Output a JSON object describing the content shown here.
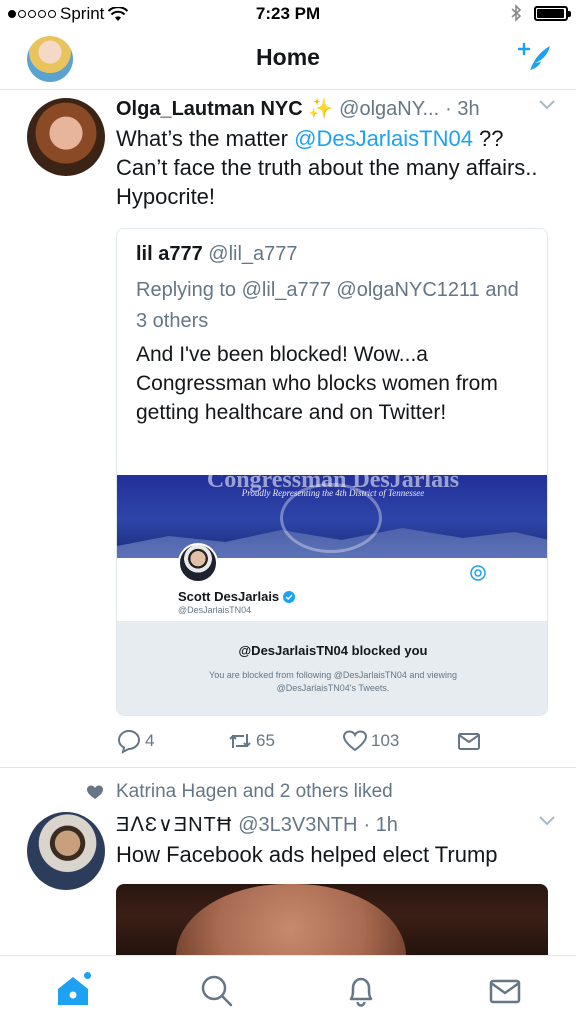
{
  "status_bar": {
    "carrier": "Sprint",
    "time": "7:23 PM",
    "battery_level": 0.95
  },
  "nav": {
    "title": "Home"
  },
  "tweets": [
    {
      "name": "Olga_Lautman NYC ✨",
      "handle": "@olgaNY...",
      "time": "· 3h",
      "text_before": "What’s the matter ",
      "mention": "@DesJarlaisTN04",
      "text_after": " ?? Can’t face the truth about the many affairs.. Hypocrite!",
      "quote": {
        "name": "lil a777",
        "handle": "@lil_a777",
        "replying_prefix": "Replying to ",
        "replying_to": "@lil_a777 @olgaNYC1211",
        "replying_suffix": " and 3 others",
        "text": "And I've been blocked! Wow...a Congressman who blocks women from getting healthcare and on Twitter!",
        "embed": {
          "banner_title": "Congressman DesJarlais",
          "banner_subtitle": "Proudly Representing the 4th District of Tennessee",
          "profile_name": "Scott DesJarlais",
          "profile_handle": "@DesJarlaisTN04",
          "blocked_title": "@DesJarlaisTN04 blocked you",
          "blocked_text": "You are blocked from following @DesJarlaisTN04 and viewing @DesJarlaisTN04's Tweets."
        }
      },
      "actions": {
        "replies": "4",
        "retweets": "65",
        "likes": "103"
      }
    },
    {
      "social_context": "Katrina Hagen and 2 others liked",
      "name": "ƎⴷƐ∨ƎΝTĦ",
      "handle": "@3L3V3NTH",
      "time": "· 1h",
      "text": "How Facebook ads helped elect Trump"
    }
  ],
  "colors": {
    "accent": "#1da1f2",
    "secondary_text": "#657786",
    "divider": "#e1e8ed"
  },
  "tabs": [
    {
      "icon": "home-icon"
    },
    {
      "icon": "search-icon"
    },
    {
      "icon": "notifications-icon"
    },
    {
      "icon": "messages-icon"
    }
  ]
}
